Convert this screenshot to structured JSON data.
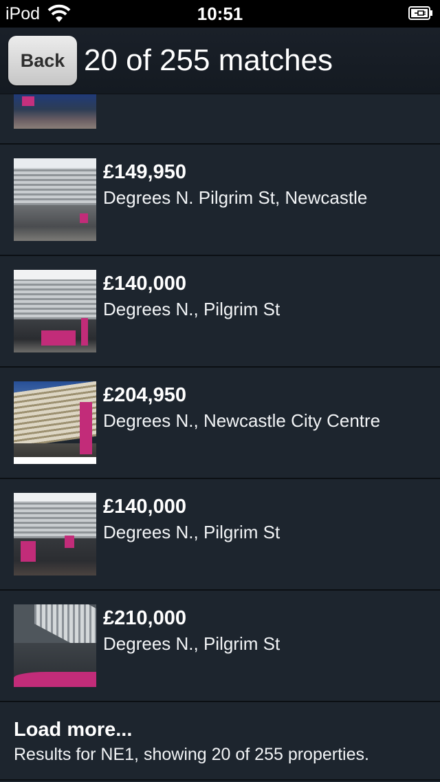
{
  "status_bar": {
    "carrier": "iPod",
    "time": "10:51"
  },
  "nav": {
    "back_label": "Back",
    "title": "20 of 255 matches"
  },
  "listings": [
    {
      "price": "£149,950",
      "address": "Degrees N. Pilgrim St, Newcastle"
    },
    {
      "price": "£140,000",
      "address": "Degrees N., Pilgrim St"
    },
    {
      "price": "£204,950",
      "address": "Degrees N., Newcastle City Centre"
    },
    {
      "price": "£140,000",
      "address": "Degrees N., Pilgrim St"
    },
    {
      "price": "£210,000",
      "address": "Degrees N., Pilgrim St"
    }
  ],
  "load_more": {
    "title": "Load more...",
    "subtitle": "Results for NE1, showing 20 of 255 properties."
  },
  "icons": {
    "wifi": "wifi-icon",
    "battery": "battery-charging-icon"
  },
  "colors": {
    "background": "#1d252e",
    "accent_magenta": "#c22c79"
  }
}
